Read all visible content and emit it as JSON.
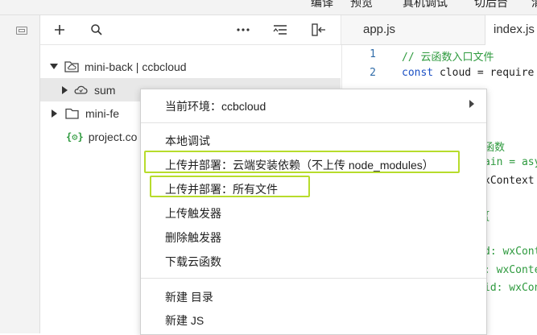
{
  "topbar": {
    "items": [
      "编译",
      "预览",
      "真机调试",
      "切后台",
      "清"
    ]
  },
  "editor_tabs": [
    {
      "label": "app.js",
      "active": false
    },
    {
      "label": "index.js",
      "active": true
    }
  ],
  "tree": {
    "items": [
      {
        "label": "mini-back | ccbcloud",
        "icon": "cloud-folder-icon",
        "expanded": true
      },
      {
        "label": "sum",
        "icon": "cloud-function-icon",
        "expanded": false,
        "selected": true
      },
      {
        "label": "mini-fe",
        "icon": "folder-icon",
        "expanded": false
      },
      {
        "label": "project.co",
        "icon": "json-file-icon"
      }
    ]
  },
  "code": {
    "lines": [
      {
        "n": "1",
        "text": "// 云函数入口文件"
      },
      {
        "n": "2",
        "text": "const cloud = require"
      }
    ],
    "fragments": [
      "函数",
      "ain = asy",
      "xContext",
      "{",
      "d: wxCont",
      ": wxConte",
      "id: wxCon"
    ]
  },
  "context_menu": {
    "env_label": "当前环境：ccbcloud",
    "items": [
      "本地调试",
      "上传并部署：云端安装依赖（不上传 node_modules）",
      "上传并部署：所有文件",
      "上传触发器",
      "删除触发器",
      "下载云函数",
      "新建 目录",
      "新建 JS"
    ]
  },
  "colors": {
    "highlight": "#b7dc2c",
    "code_green": "#2e9a3e",
    "code_blue": "#1a4fc4"
  }
}
